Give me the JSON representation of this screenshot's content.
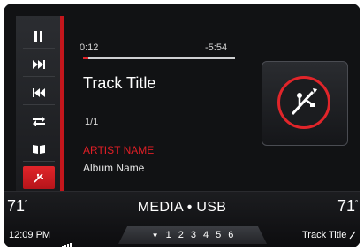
{
  "controls": {
    "pause_icon": "pause-icon",
    "next_icon": "skip-forward-icon",
    "prev_icon": "skip-back-icon",
    "repeat_icon": "repeat-icon",
    "browse_icon": "browse-icon",
    "usb_icon": "usb-icon"
  },
  "progress": {
    "elapsed": "0:12",
    "remaining": "-5:54",
    "fraction": 0.034
  },
  "track": {
    "title": "Track Title",
    "count": "1/1",
    "artist": "ARTIST NAME",
    "album": "Album Name"
  },
  "status": {
    "temp_left": "71",
    "temp_right": "71",
    "temp_unit": "°",
    "source": "MEDIA • USB",
    "clock": "12:09 PM",
    "presets": [
      "1",
      "2",
      "3",
      "4",
      "5",
      "6"
    ],
    "now_playing": "Track Title"
  },
  "colors": {
    "accent": "#e1252a",
    "background": "#111214"
  }
}
